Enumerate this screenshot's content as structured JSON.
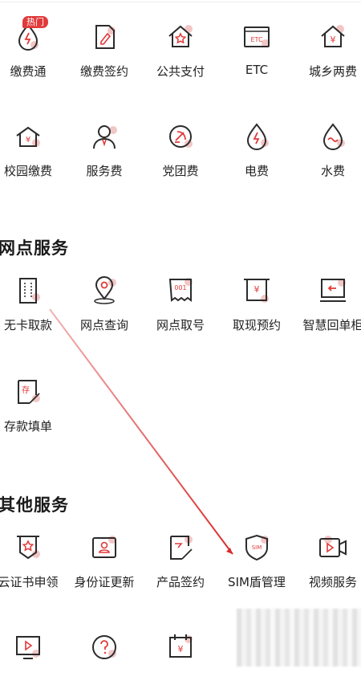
{
  "colors": {
    "accent": "#e03a3a",
    "icon_stroke": "#2b2b2b",
    "icon_dot": "#e8a0a0"
  },
  "grid_top": {
    "row1": [
      {
        "label": "缴费通",
        "icon": "lightning-drop-icon",
        "badge": "热门"
      },
      {
        "label": "缴费签约",
        "icon": "pen-document-icon"
      },
      {
        "label": "公共支付",
        "icon": "star-house-icon"
      },
      {
        "label": "ETC",
        "icon": "etc-card-icon"
      },
      {
        "label": "城乡两费",
        "icon": "yuan-house-icon"
      }
    ],
    "row2": [
      {
        "label": "校园缴费",
        "icon": "yuan-school-icon"
      },
      {
        "label": "服务费",
        "icon": "service-person-icon"
      },
      {
        "label": "党团费",
        "icon": "party-emblem-icon"
      },
      {
        "label": "电费",
        "icon": "electricity-drop-icon"
      },
      {
        "label": "水费",
        "icon": "water-drop-icon"
      }
    ]
  },
  "branch_services": {
    "title": "网点服务",
    "row1": [
      {
        "label": "无卡取款",
        "icon": "cardless-withdraw-icon"
      },
      {
        "label": "网点查询",
        "icon": "location-pin-icon"
      },
      {
        "label": "网点取号",
        "icon": "queue-ticket-icon"
      },
      {
        "label": "取现预约",
        "icon": "cash-reserve-icon"
      },
      {
        "label": "智慧回单柜",
        "icon": "receipt-cabinet-icon"
      }
    ],
    "row2": [
      {
        "label": "存款填单",
        "icon": "deposit-form-icon"
      }
    ]
  },
  "other_services": {
    "title": "其他服务",
    "row1": [
      {
        "label": "云证书申领",
        "icon": "cloud-certificate-icon"
      },
      {
        "label": "身份证更新",
        "icon": "id-card-icon"
      },
      {
        "label": "产品签约",
        "icon": "product-sign-icon"
      },
      {
        "label": "SIM盾管理",
        "icon": "sim-shield-icon",
        "icon_text": "SIM"
      },
      {
        "label": "视频服务",
        "icon": "video-camera-icon"
      }
    ],
    "row2": [
      {
        "label": "",
        "icon": "play-video-icon"
      },
      {
        "label": "",
        "icon": "question-circle-icon"
      },
      {
        "label": "",
        "icon": "calendar-yuan-icon"
      }
    ]
  },
  "icon_text": {
    "etc": "ETC",
    "yuan": "¥",
    "ticket": "001",
    "deposit": "存"
  }
}
